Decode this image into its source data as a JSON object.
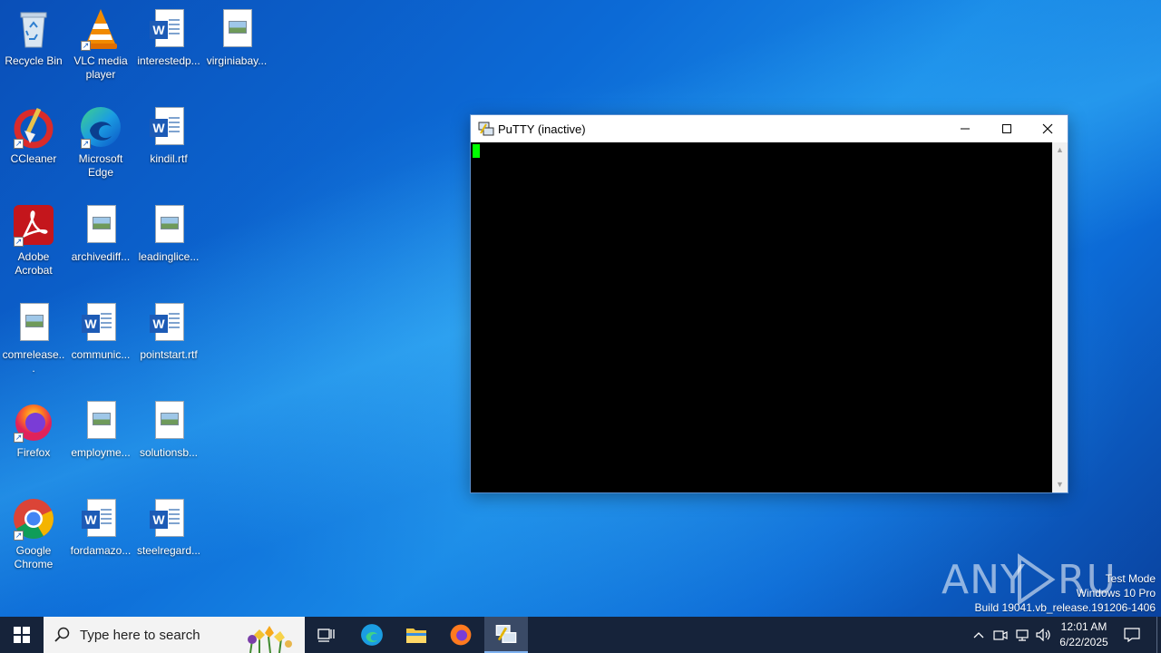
{
  "desktop": {
    "icons": [
      {
        "label": "Recycle Bin",
        "icon": "recycle-bin-icon"
      },
      {
        "label": "VLC media player",
        "icon": "vlc-icon"
      },
      {
        "label": "interestedp...",
        "icon": "word-doc-icon"
      },
      {
        "label": "virginiabay...",
        "icon": "image-doc-icon"
      },
      {
        "label": "CCleaner",
        "icon": "ccleaner-icon"
      },
      {
        "label": "Microsoft Edge",
        "icon": "edge-icon"
      },
      {
        "label": "kindil.rtf",
        "icon": "word-doc-icon"
      },
      {
        "label": "Adobe Acrobat",
        "icon": "acrobat-icon"
      },
      {
        "label": "archivediff...",
        "icon": "image-doc-icon"
      },
      {
        "label": "leadinglice...",
        "icon": "image-doc-icon"
      },
      {
        "label": "comrelease...",
        "icon": "image-doc-icon"
      },
      {
        "label": "communic...",
        "icon": "word-doc-icon"
      },
      {
        "label": "pointstart.rtf",
        "icon": "word-doc-icon"
      },
      {
        "label": "Firefox",
        "icon": "firefox-icon"
      },
      {
        "label": "employme...",
        "icon": "image-doc-icon"
      },
      {
        "label": "solutionsb...",
        "icon": "image-doc-icon"
      },
      {
        "label": "Google Chrome",
        "icon": "chrome-icon"
      },
      {
        "label": "fordamazo...",
        "icon": "word-doc-icon"
      },
      {
        "label": "steelregard...",
        "icon": "word-doc-icon"
      }
    ]
  },
  "putty": {
    "title": "PuTTY (inactive)",
    "cursor_color": "#00ff00"
  },
  "watermark": {
    "brand": "ANY RUN",
    "line1": "Test Mode",
    "line2": "Windows 10 Pro",
    "line3": "Build 19041.vb_release.191206-1406"
  },
  "taskbar": {
    "search_placeholder": "Type here to search",
    "time": "12:01 AM",
    "date": "6/22/2025"
  }
}
